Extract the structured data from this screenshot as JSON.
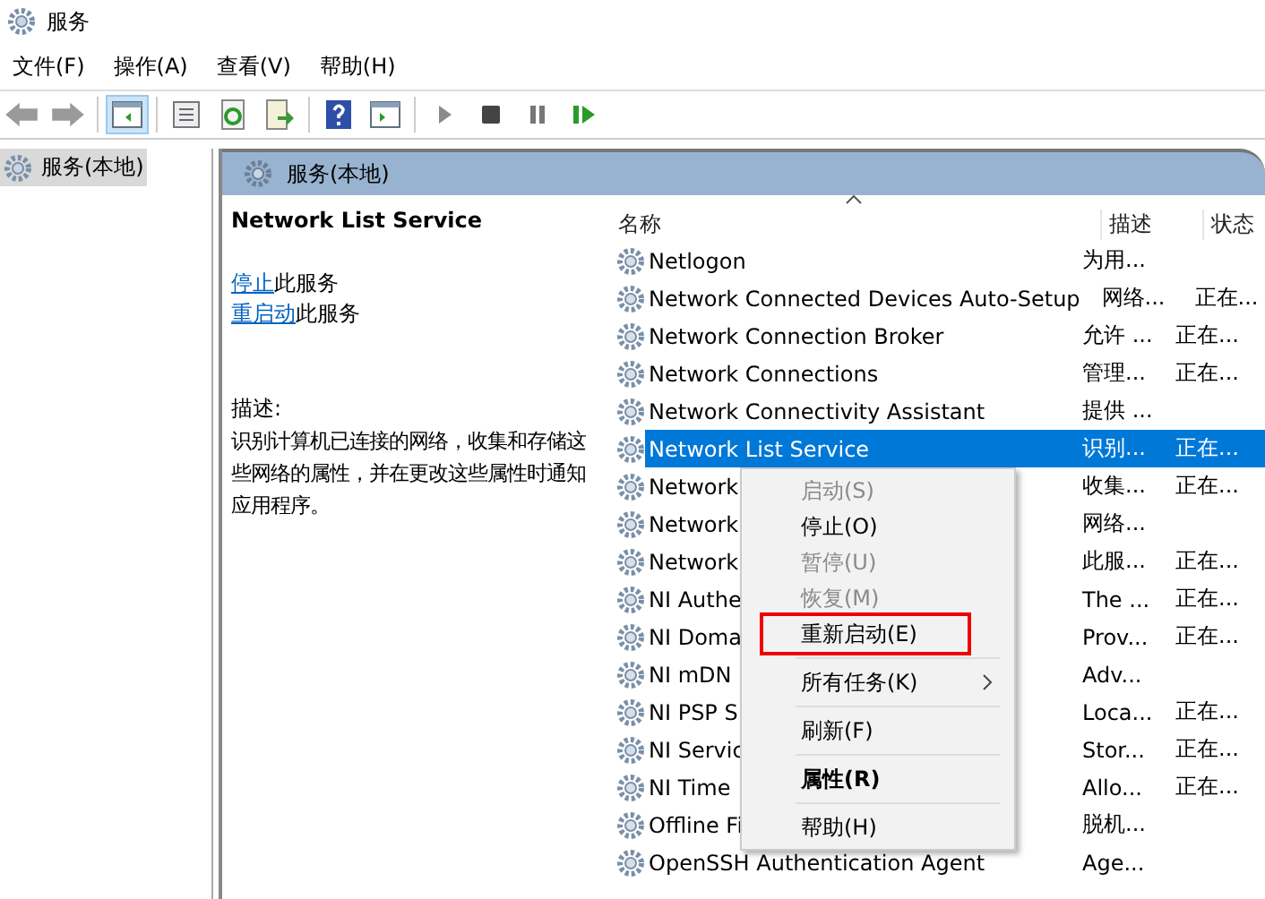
{
  "window": {
    "title": "服务"
  },
  "menu_bar": [
    "文件(F)",
    "操作(A)",
    "查看(V)",
    "帮助(H)"
  ],
  "toolbar": {
    "show_tree_selected": true
  },
  "tree": {
    "items": [
      {
        "label": "服务(本地)",
        "selected": true
      }
    ]
  },
  "pane_header": "服务(本地)",
  "details": {
    "title": "Network List Service",
    "actions": [
      {
        "link": "停止",
        "text": "此服务"
      },
      {
        "link": "重启动",
        "text": "此服务"
      }
    ],
    "description_label": "描述:",
    "description": "识别计算机已连接的网络，收集和存储这些网络的属性，并在更改这些属性时通知应用程序。"
  },
  "table": {
    "columns": [
      "名称",
      "描述",
      "状态"
    ],
    "rows": [
      {
        "name": "Netlogon",
        "description": "为用...",
        "status": "",
        "selected": false
      },
      {
        "name": "Network Connected Devices Auto-Setup",
        "description": "网络...",
        "status": "正在...",
        "selected": false
      },
      {
        "name": "Network Connection Broker",
        "description": "允许 ...",
        "status": "正在...",
        "selected": false
      },
      {
        "name": "Network Connections",
        "description": "管理...",
        "status": "正在...",
        "selected": false
      },
      {
        "name": "Network Connectivity Assistant",
        "description": "提供 ...",
        "status": "",
        "selected": false
      },
      {
        "name": "Network List Service",
        "description": "识别...",
        "status": "正在...",
        "selected": true
      },
      {
        "name": "Network",
        "description": "收集...",
        "status": "正在...",
        "selected": false
      },
      {
        "name": "Network",
        "description": "网络...",
        "status": "",
        "selected": false
      },
      {
        "name": "Network",
        "description": "此服...",
        "status": "正在...",
        "selected": false
      },
      {
        "name": "NI Authe",
        "description": "The ...",
        "status": "正在...",
        "selected": false
      },
      {
        "name": "NI Doma",
        "description": "Prov...",
        "status": "正在...",
        "selected": false
      },
      {
        "name": "NI mDN",
        "description": "Adv...",
        "status": "",
        "selected": false
      },
      {
        "name": "NI PSP S",
        "description": "Loca...",
        "status": "正在...",
        "selected": false
      },
      {
        "name": "NI Servic",
        "description": "Stor...",
        "status": "正在...",
        "selected": false
      },
      {
        "name": "NI Time",
        "description": "Allo...",
        "status": "正在...",
        "selected": false
      },
      {
        "name": "Offline Fi",
        "description": "脱机...",
        "status": "",
        "selected": false
      },
      {
        "name": "OpenSSH Authentication Agent",
        "description": "Age...",
        "status": "",
        "selected": false
      }
    ]
  },
  "context_menu": [
    {
      "kind": "item",
      "label": "启动(S)",
      "disabled": true,
      "highlighted": false,
      "bold": false,
      "submenu": false
    },
    {
      "kind": "item",
      "label": "停止(O)",
      "disabled": false,
      "highlighted": false,
      "bold": false,
      "submenu": false
    },
    {
      "kind": "item",
      "label": "暂停(U)",
      "disabled": true,
      "highlighted": false,
      "bold": false,
      "submenu": false
    },
    {
      "kind": "item",
      "label": "恢复(M)",
      "disabled": true,
      "highlighted": false,
      "bold": false,
      "submenu": false
    },
    {
      "kind": "item",
      "label": "重新启动(E)",
      "disabled": false,
      "highlighted": true,
      "bold": false,
      "submenu": false
    },
    {
      "kind": "separator"
    },
    {
      "kind": "item",
      "label": "所有任务(K)",
      "disabled": false,
      "highlighted": false,
      "bold": false,
      "submenu": true
    },
    {
      "kind": "separator"
    },
    {
      "kind": "item",
      "label": "刷新(F)",
      "disabled": false,
      "highlighted": false,
      "bold": false,
      "submenu": false
    },
    {
      "kind": "separator"
    },
    {
      "kind": "item",
      "label": "属性(R)",
      "disabled": false,
      "highlighted": false,
      "bold": true,
      "submenu": false
    },
    {
      "kind": "separator"
    },
    {
      "kind": "item",
      "label": "帮助(H)",
      "disabled": false,
      "highlighted": false,
      "bold": false,
      "submenu": false
    }
  ]
}
